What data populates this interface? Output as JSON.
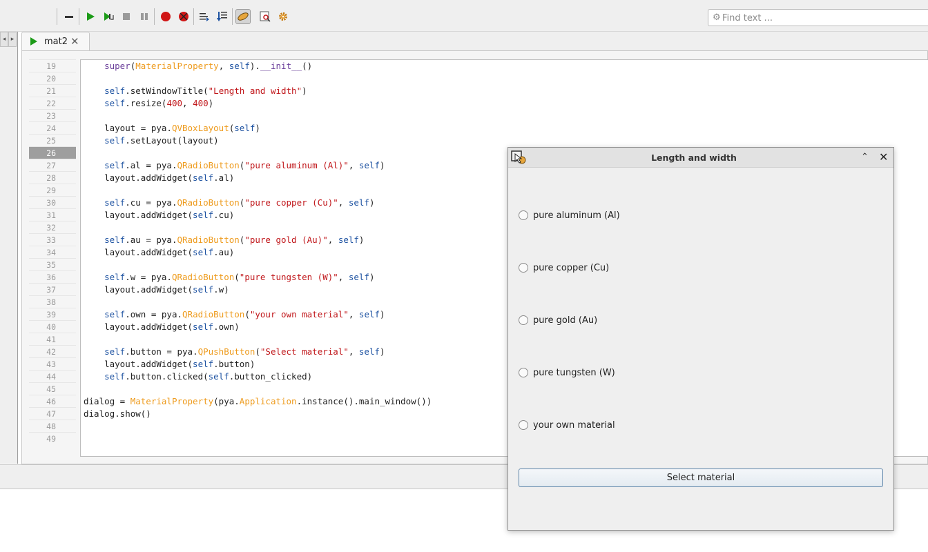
{
  "toolbar": {
    "buttons": [
      {
        "name": "collapse-icon"
      },
      {
        "name": "run-icon"
      },
      {
        "name": "run-step-icon"
      },
      {
        "name": "stop-icon"
      },
      {
        "name": "pause-icon"
      },
      {
        "name": "breakpoint-icon"
      },
      {
        "name": "clear-breakpoints-icon"
      },
      {
        "name": "step-over-icon"
      },
      {
        "name": "step-into-icon"
      },
      {
        "name": "edit-mode-icon"
      },
      {
        "name": "inspect-icon"
      },
      {
        "name": "settings-icon"
      }
    ],
    "find_placeholder": "Find text ..."
  },
  "tab": {
    "label": "mat2"
  },
  "editor": {
    "current_line": 26,
    "line_numbers": [
      "19",
      "20",
      "21",
      "22",
      "23",
      "24",
      "25",
      "26",
      "27",
      "28",
      "29",
      "30",
      "31",
      "32",
      "33",
      "34",
      "35",
      "36",
      "37",
      "38",
      "39",
      "40",
      "41",
      "42",
      "43",
      "44",
      "45",
      "46",
      "47",
      "48",
      "49"
    ],
    "code_lines": [
      {
        "indent": "    ",
        "tokens": [
          {
            "t": "super",
            "c": "sp"
          },
          {
            "t": "(",
            "c": "fn"
          },
          {
            "t": "MaterialProperty",
            "c": "cls"
          },
          {
            "t": ", ",
            "c": "fn"
          },
          {
            "t": "self",
            "c": "kw"
          },
          {
            "t": ").",
            "c": "fn"
          },
          {
            "t": "__init__",
            "c": "sp"
          },
          {
            "t": "()",
            "c": "fn"
          }
        ]
      },
      {
        "indent": "",
        "tokens": []
      },
      {
        "indent": "    ",
        "tokens": [
          {
            "t": "self",
            "c": "kw"
          },
          {
            "t": ".setWindowTitle(",
            "c": "fn"
          },
          {
            "t": "\"Length and width\"",
            "c": "str"
          },
          {
            "t": ")",
            "c": "fn"
          }
        ]
      },
      {
        "indent": "    ",
        "tokens": [
          {
            "t": "self",
            "c": "kw"
          },
          {
            "t": ".resize(",
            "c": "fn"
          },
          {
            "t": "400",
            "c": "num"
          },
          {
            "t": ", ",
            "c": "fn"
          },
          {
            "t": "400",
            "c": "num"
          },
          {
            "t": ")",
            "c": "fn"
          }
        ]
      },
      {
        "indent": "",
        "tokens": []
      },
      {
        "indent": "    ",
        "tokens": [
          {
            "t": "layout = pya.",
            "c": "fn"
          },
          {
            "t": "QVBoxLayout",
            "c": "cls"
          },
          {
            "t": "(",
            "c": "fn"
          },
          {
            "t": "self",
            "c": "kw"
          },
          {
            "t": ")",
            "c": "fn"
          }
        ]
      },
      {
        "indent": "    ",
        "tokens": [
          {
            "t": "self",
            "c": "kw"
          },
          {
            "t": ".setLayout(layout)",
            "c": "fn"
          }
        ]
      },
      {
        "indent": "",
        "tokens": []
      },
      {
        "indent": "    ",
        "tokens": [
          {
            "t": "self",
            "c": "kw"
          },
          {
            "t": ".al = pya.",
            "c": "fn"
          },
          {
            "t": "QRadioButton",
            "c": "cls"
          },
          {
            "t": "(",
            "c": "fn"
          },
          {
            "t": "\"pure aluminum (Al)\"",
            "c": "str"
          },
          {
            "t": ", ",
            "c": "fn"
          },
          {
            "t": "self",
            "c": "kw"
          },
          {
            "t": ")",
            "c": "fn"
          }
        ]
      },
      {
        "indent": "    ",
        "tokens": [
          {
            "t": "layout.addWidget(",
            "c": "fn"
          },
          {
            "t": "self",
            "c": "kw"
          },
          {
            "t": ".al)",
            "c": "fn"
          }
        ]
      },
      {
        "indent": "",
        "tokens": []
      },
      {
        "indent": "    ",
        "tokens": [
          {
            "t": "self",
            "c": "kw"
          },
          {
            "t": ".cu = pya.",
            "c": "fn"
          },
          {
            "t": "QRadioButton",
            "c": "cls"
          },
          {
            "t": "(",
            "c": "fn"
          },
          {
            "t": "\"pure copper (Cu)\"",
            "c": "str"
          },
          {
            "t": ", ",
            "c": "fn"
          },
          {
            "t": "self",
            "c": "kw"
          },
          {
            "t": ")",
            "c": "fn"
          }
        ]
      },
      {
        "indent": "    ",
        "tokens": [
          {
            "t": "layout.addWidget(",
            "c": "fn"
          },
          {
            "t": "self",
            "c": "kw"
          },
          {
            "t": ".cu)",
            "c": "fn"
          }
        ]
      },
      {
        "indent": "",
        "tokens": []
      },
      {
        "indent": "    ",
        "tokens": [
          {
            "t": "self",
            "c": "kw"
          },
          {
            "t": ".au = pya.",
            "c": "fn"
          },
          {
            "t": "QRadioButton",
            "c": "cls"
          },
          {
            "t": "(",
            "c": "fn"
          },
          {
            "t": "\"pure gold (Au)\"",
            "c": "str"
          },
          {
            "t": ", ",
            "c": "fn"
          },
          {
            "t": "self",
            "c": "kw"
          },
          {
            "t": ")",
            "c": "fn"
          }
        ]
      },
      {
        "indent": "    ",
        "tokens": [
          {
            "t": "layout.addWidget(",
            "c": "fn"
          },
          {
            "t": "self",
            "c": "kw"
          },
          {
            "t": ".au)",
            "c": "fn"
          }
        ]
      },
      {
        "indent": "",
        "tokens": []
      },
      {
        "indent": "    ",
        "tokens": [
          {
            "t": "self",
            "c": "kw"
          },
          {
            "t": ".w = pya.",
            "c": "fn"
          },
          {
            "t": "QRadioButton",
            "c": "cls"
          },
          {
            "t": "(",
            "c": "fn"
          },
          {
            "t": "\"pure tungsten (W)\"",
            "c": "str"
          },
          {
            "t": ", ",
            "c": "fn"
          },
          {
            "t": "self",
            "c": "kw"
          },
          {
            "t": ")",
            "c": "fn"
          }
        ]
      },
      {
        "indent": "    ",
        "tokens": [
          {
            "t": "layout.addWidget(",
            "c": "fn"
          },
          {
            "t": "self",
            "c": "kw"
          },
          {
            "t": ".w)",
            "c": "fn"
          }
        ]
      },
      {
        "indent": "",
        "tokens": []
      },
      {
        "indent": "    ",
        "tokens": [
          {
            "t": "self",
            "c": "kw"
          },
          {
            "t": ".own = pya.",
            "c": "fn"
          },
          {
            "t": "QRadioButton",
            "c": "cls"
          },
          {
            "t": "(",
            "c": "fn"
          },
          {
            "t": "\"your own material\"",
            "c": "str"
          },
          {
            "t": ", ",
            "c": "fn"
          },
          {
            "t": "self",
            "c": "kw"
          },
          {
            "t": ")",
            "c": "fn"
          }
        ]
      },
      {
        "indent": "    ",
        "tokens": [
          {
            "t": "layout.addWidget(",
            "c": "fn"
          },
          {
            "t": "self",
            "c": "kw"
          },
          {
            "t": ".own)",
            "c": "fn"
          }
        ]
      },
      {
        "indent": "",
        "tokens": []
      },
      {
        "indent": "    ",
        "tokens": [
          {
            "t": "self",
            "c": "kw"
          },
          {
            "t": ".button = pya.",
            "c": "fn"
          },
          {
            "t": "QPushButton",
            "c": "cls"
          },
          {
            "t": "(",
            "c": "fn"
          },
          {
            "t": "\"Select material\"",
            "c": "str"
          },
          {
            "t": ", ",
            "c": "fn"
          },
          {
            "t": "self",
            "c": "kw"
          },
          {
            "t": ")",
            "c": "fn"
          }
        ]
      },
      {
        "indent": "    ",
        "tokens": [
          {
            "t": "layout.addWidget(",
            "c": "fn"
          },
          {
            "t": "self",
            "c": "kw"
          },
          {
            "t": ".button)",
            "c": "fn"
          }
        ]
      },
      {
        "indent": "    ",
        "tokens": [
          {
            "t": "self",
            "c": "kw"
          },
          {
            "t": ".button.clicked(",
            "c": "fn"
          },
          {
            "t": "self",
            "c": "kw"
          },
          {
            "t": ".button_clicked)",
            "c": "fn"
          }
        ]
      },
      {
        "indent": "",
        "tokens": []
      },
      {
        "indent": "",
        "tokens": [
          {
            "t": "dialog = ",
            "c": "fn"
          },
          {
            "t": "MaterialProperty",
            "c": "cls"
          },
          {
            "t": "(pya.",
            "c": "fn"
          },
          {
            "t": "Application",
            "c": "cls"
          },
          {
            "t": ".instance().main_window())",
            "c": "fn"
          }
        ]
      },
      {
        "indent": "",
        "tokens": [
          {
            "t": "dialog.show()",
            "c": "fn"
          }
        ]
      },
      {
        "indent": "",
        "tokens": []
      },
      {
        "indent": "",
        "tokens": []
      }
    ]
  },
  "dialog": {
    "title": "Length and width",
    "options": [
      {
        "label": "pure aluminum (Al)"
      },
      {
        "label": "pure copper (Cu)"
      },
      {
        "label": "pure gold (Au)"
      },
      {
        "label": "pure tungsten (W)"
      },
      {
        "label": "your own material"
      }
    ],
    "button_label": "Select material"
  },
  "colors": {
    "keyword": "#1d52a1",
    "class": "#ee9b1d",
    "string": "#c0161a",
    "run_green": "#1c9b18",
    "record_red": "#d01616"
  }
}
